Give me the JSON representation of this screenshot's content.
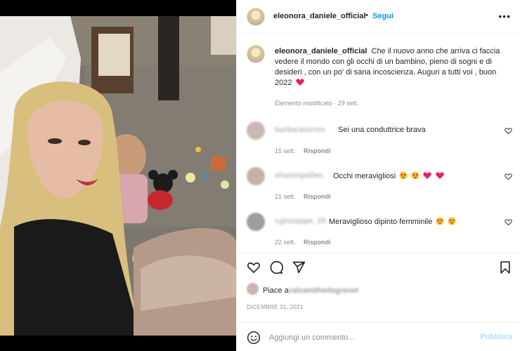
{
  "post": {
    "username": "eleonora_daniele_official",
    "separator": "•",
    "follow_label": "Segui",
    "more_label": "•••",
    "caption": "Che il nuovo anno che arriva ci faccia vedere il mondo con gli occhi di un bambino, pieno di sogni e di desideri , con un po' di sana incoscienza. Auguri a tutti voi , buon 2022",
    "caption_emoji": "red-heart-icon",
    "edited_label": "Elemento modificato",
    "edited_dot": "·",
    "edited_time": "29 sett."
  },
  "comments": [
    {
      "username": "barbaratorres",
      "text": "Sei una conduttrice brava",
      "time": "15 sett.",
      "reply_label": "Rispondi",
      "emojis": []
    },
    {
      "username": "sharonpallen",
      "text": "Occhi meravigliosi",
      "time": "21 sett.",
      "reply_label": "Rispondi",
      "emojis": [
        "star-eyes-icon",
        "star-eyes-icon",
        "red-heart-icon",
        "red-heart-icon"
      ]
    },
    {
      "username": "cgiuseppe_25",
      "text": "Meraviglioso dipinto femminile",
      "time": "22 sett.",
      "reply_label": "Rispondi",
      "emojis": [
        "star-eyes-icon",
        "star-eyes-icon"
      ]
    }
  ],
  "likes": {
    "prefix": "Piace a",
    "user": "salvamthedegrenet"
  },
  "date": "DICEMBRE 31, 2021",
  "composer": {
    "placeholder": "Aggiungi un commento...",
    "publish_label": "Pubblica"
  },
  "colors": {
    "accent": "#0095f6",
    "publish_disabled": "#b2dffc",
    "heart_red": "#ed4956",
    "meta_gray": "#8e8e8e"
  }
}
